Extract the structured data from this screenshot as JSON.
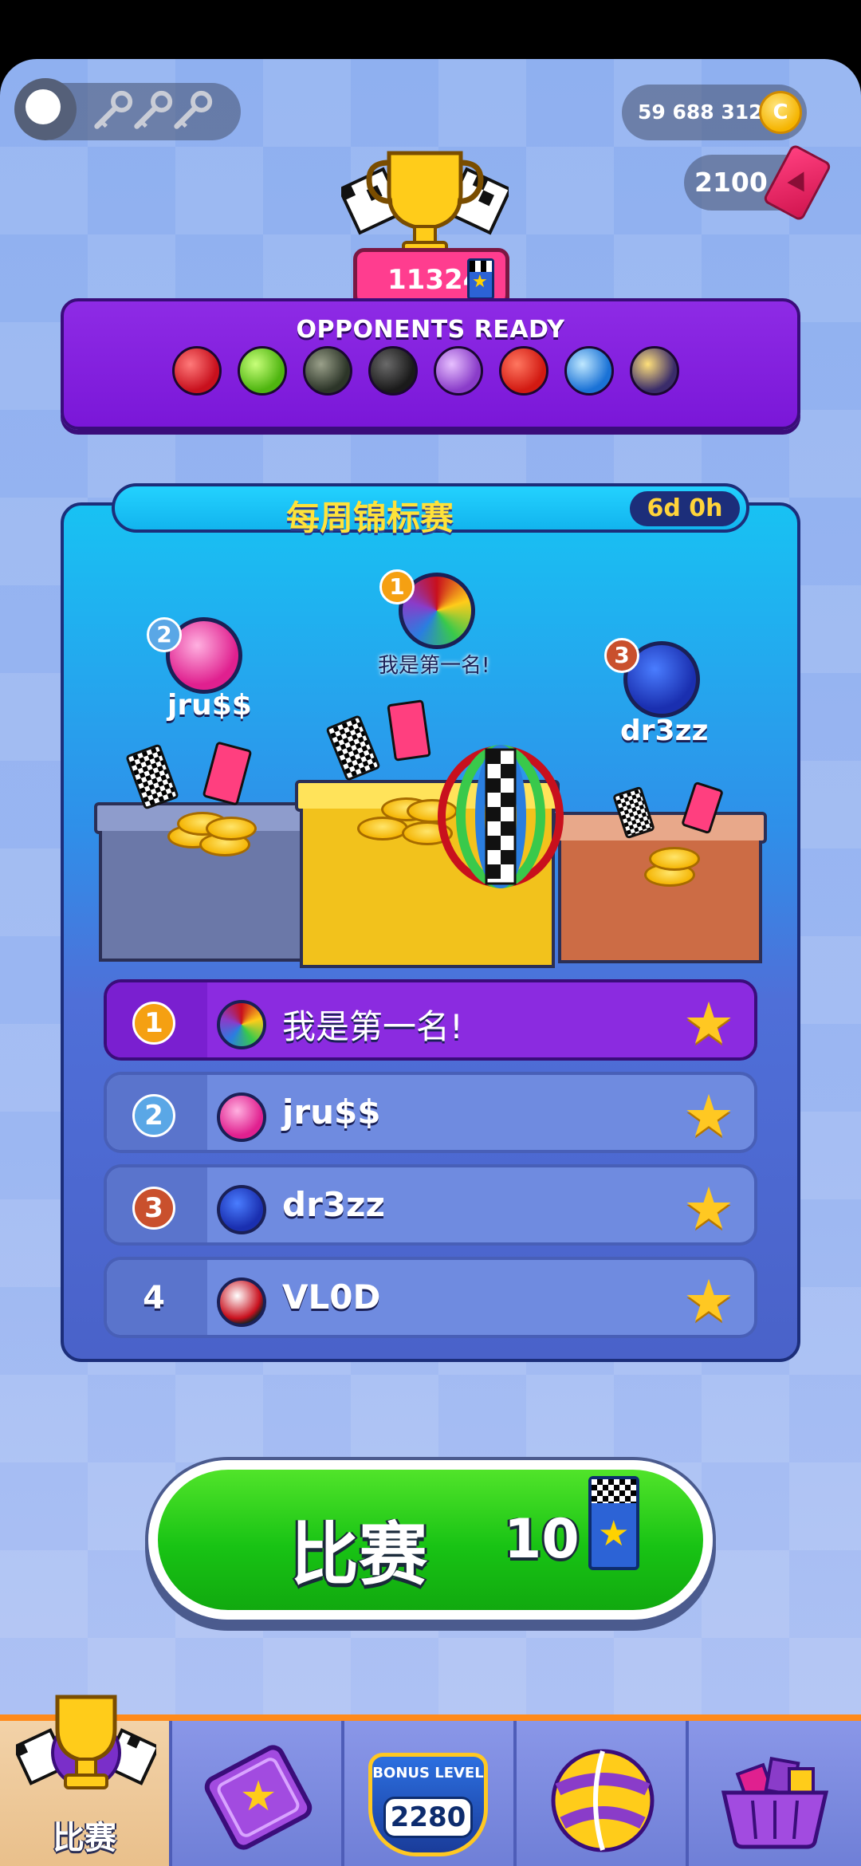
{
  "currency": {
    "coins": "59 688 312",
    "coin_symbol": "C",
    "tickets": "2100"
  },
  "trophy_score": "11324",
  "opponents": {
    "title": "OPPONENTS READY",
    "balls": [
      "soda-can-ball",
      "apple-ball",
      "tennis-ball",
      "bomb-ball",
      "spiky-purple-ball",
      "tomato-ball",
      "blue-candy-ball",
      "armored-ball"
    ]
  },
  "tournament": {
    "title": "每周锦标赛",
    "timer": "6d 0h",
    "podium": [
      {
        "rank": "1",
        "name": "我是第一名!"
      },
      {
        "rank": "2",
        "name": "jru$$"
      },
      {
        "rank": "3",
        "name": "dr3zz"
      }
    ],
    "leaderboard": [
      {
        "rank": "1",
        "name": "我是第一名!",
        "star": "★"
      },
      {
        "rank": "2",
        "name": "jru$$",
        "star": "★"
      },
      {
        "rank": "3",
        "name": "dr3zz",
        "star": "★"
      },
      {
        "rank": "4",
        "name": "VL0D",
        "star": "★"
      }
    ]
  },
  "play_button": {
    "label": "比赛",
    "cost": "10"
  },
  "bottom_nav": {
    "tabs": [
      {
        "label": "比赛",
        "icon": "trophy-icon",
        "active": true
      },
      {
        "label": "",
        "icon": "star-card-icon"
      },
      {
        "label": "",
        "icon": "bonus-level-icon",
        "bonus_title": "BONUS LEVEL",
        "bonus_value": "2280"
      },
      {
        "label": "",
        "icon": "ball-skin-icon"
      },
      {
        "label": "",
        "icon": "shop-basket-icon"
      }
    ]
  },
  "colors": {
    "accent_orange": "#ff8a1a",
    "play_green": "#18c314",
    "panel_purple": "#7a17d8",
    "leader_highlight": "#8b2be0",
    "star_gold": "#ffc822"
  }
}
